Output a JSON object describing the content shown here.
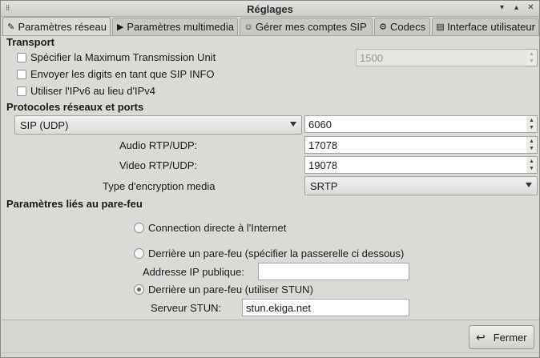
{
  "window": {
    "title": "Réglages"
  },
  "tabs": [
    {
      "label": "Paramètres réseau",
      "icon": "wrench-icon"
    },
    {
      "label": "Paramètres multimedia",
      "icon": "play-icon"
    },
    {
      "label": "Gérer mes comptes SIP",
      "icon": "accounts-icon"
    },
    {
      "label": "Codecs",
      "icon": "gear-icon"
    },
    {
      "label": "Interface utilisateur",
      "icon": "document-icon"
    }
  ],
  "transport": {
    "heading": "Transport",
    "mtu_label": "Spécifier la Maximum Transmission Unit",
    "mtu_value": "1500",
    "sip_info_label": "Envoyer les digits en tant que SIP INFO",
    "ipv6_label": "Utiliser l'IPv6 au lieu d'IPv4"
  },
  "protocols": {
    "heading": "Protocoles réseaux et ports",
    "protocol_selected": "SIP (UDP)",
    "sip_port": "6060",
    "audio_label": "Audio RTP/UDP:",
    "audio_port": "17078",
    "video_label": "Video RTP/UDP:",
    "video_port": "19078",
    "encryption_label": "Type d'encryption media",
    "encryption_selected": "SRTP"
  },
  "firewall": {
    "heading": "Paramètres liés au pare-feu",
    "direct_label": "Connection directe à l'Internet",
    "nat_label": "Derrière un pare-feu (spécifier la passerelle ci dessous)",
    "public_ip_label": "Addresse IP publique:",
    "public_ip_value": "",
    "stun_option_label": "Derrière un pare-feu (utiliser STUN)",
    "stun_server_label": "Serveur STUN:",
    "stun_server_value": "stun.ekiga.net",
    "selected": "stun"
  },
  "footer": {
    "close_label": "Fermer"
  }
}
